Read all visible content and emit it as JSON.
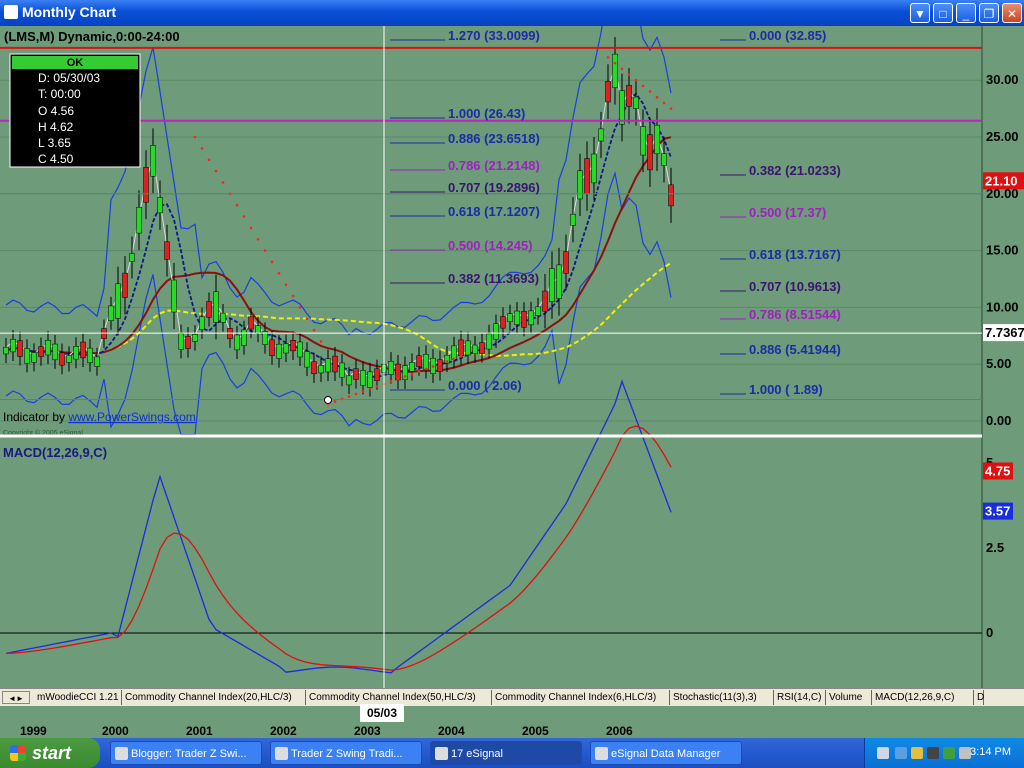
{
  "window": {
    "title": "Monthly Chart"
  },
  "chart": {
    "symbol_label": "(LMS,M) Dynamic,0:00-24:00",
    "ohlc_box": {
      "ok": "OK",
      "date": "D: 05/30/03",
      "time": "T: 00:00",
      "open": "O  4.56",
      "high": "H  4.62",
      "low": "L  3.65",
      "close": "C  4.50"
    },
    "indicator_credit": "Indicator by ",
    "indicator_link": "www.PowerSwings.com",
    "copyright": "Copyright © 2005 eSignal",
    "price_axis_ticks": [
      "30.00",
      "25.00",
      "20.00",
      "15.00",
      "10.00",
      "5.00",
      "0.00"
    ],
    "price_value_tags": [
      {
        "label": "21.10",
        "color": "#e01010"
      },
      {
        "label": "7.7367",
        "color": "#ffffff"
      }
    ],
    "fib_left": [
      "1.270 (33.0099)",
      "1.000 (26.43)",
      "0.886 (23.6518)",
      "0.786 (21.2148)",
      "0.707 (19.2896)",
      "0.618 (17.1207)",
      "0.500 (14.245)",
      "0.382 (11.3693)",
      "0.000 ( 2.06)"
    ],
    "fib_right": [
      "0.000 (32.85)",
      "0.382 (21.0233)",
      "0.500 (17.37)",
      "0.618 (13.7167)",
      "0.707 (10.9613)",
      "0.786 (8.51544)",
      "0.886 (5.41944)",
      "1.000 ( 1.89)"
    ],
    "macd_label": "MACD(12,26,9,C)",
    "macd_axis_ticks": [
      "5",
      "2.5",
      "0"
    ],
    "macd_value_tags": [
      "4.75",
      "3.57"
    ],
    "colors": {
      "background": "#6e9b79",
      "up_candle": "#22dd22",
      "down_candle": "#dd2020",
      "fib_blue": "#1a2ca8",
      "fib_magenta": "#a020c0",
      "bollinger": "#1a3fe0",
      "ma_yellow": "#f0f000",
      "ma_maroon": "#8b1010"
    }
  },
  "tabs": [
    "mWoodieCCI 1.21",
    "Commodity Channel Index(20,HLC/3)",
    "Commodity Channel Index(50,HLC/3)",
    "Commodity Channel Index(6,HLC/3)",
    "Stochastic(11(3),3)",
    "RSI(14,C)",
    "Volume",
    "MACD(12,26,9,C)",
    "D"
  ],
  "xaxis": {
    "labels": [
      "1999",
      "2000",
      "2001",
      "2002",
      "2003",
      "2004",
      "2005",
      "2006"
    ],
    "cursor_label": "05/03"
  },
  "taskbar": {
    "start": "start",
    "items": [
      "Blogger: Trader Z Swi...",
      "Trader Z Swing Tradi...",
      "17 eSignal",
      "eSignal Data Manager"
    ],
    "clock": "3:14 PM"
  }
}
